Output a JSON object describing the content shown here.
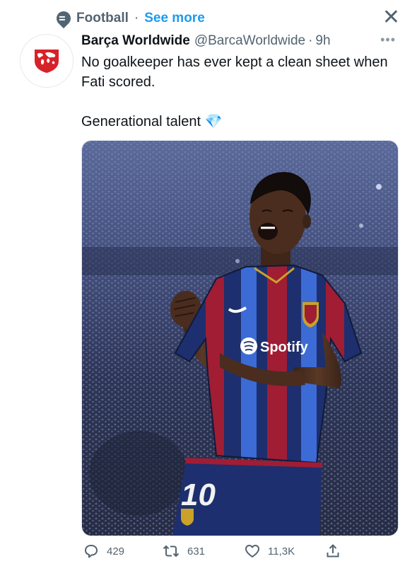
{
  "context": {
    "topic": "Football",
    "separator": "·",
    "see_more": "See more",
    "close_icon": "close-icon",
    "topic_icon": "topic-icon"
  },
  "tweet": {
    "author_name": "Barça Worldwide",
    "handle": "@BarcaWorldwide",
    "dot": "·",
    "time": "9h",
    "more_icon": "more-dots-icon",
    "text": "No goalkeeper has ever kept a clean sheet when Fati scored.\n\nGenerational talent",
    "emoji": "💎",
    "media": {
      "jersey_sponsor": "Spotify",
      "shorts_number": "10"
    }
  },
  "actions": {
    "replies": "429",
    "retweets": "631",
    "likes": "11,3K",
    "reply_icon": "reply-icon",
    "retweet_icon": "retweet-icon",
    "like_icon": "heart-icon",
    "share_icon": "share-icon"
  },
  "colors": {
    "accent": "#1d9bf0",
    "secondary_text": "#536471",
    "primary_text": "#0f1419",
    "avatar_logo": "#d7222a"
  }
}
